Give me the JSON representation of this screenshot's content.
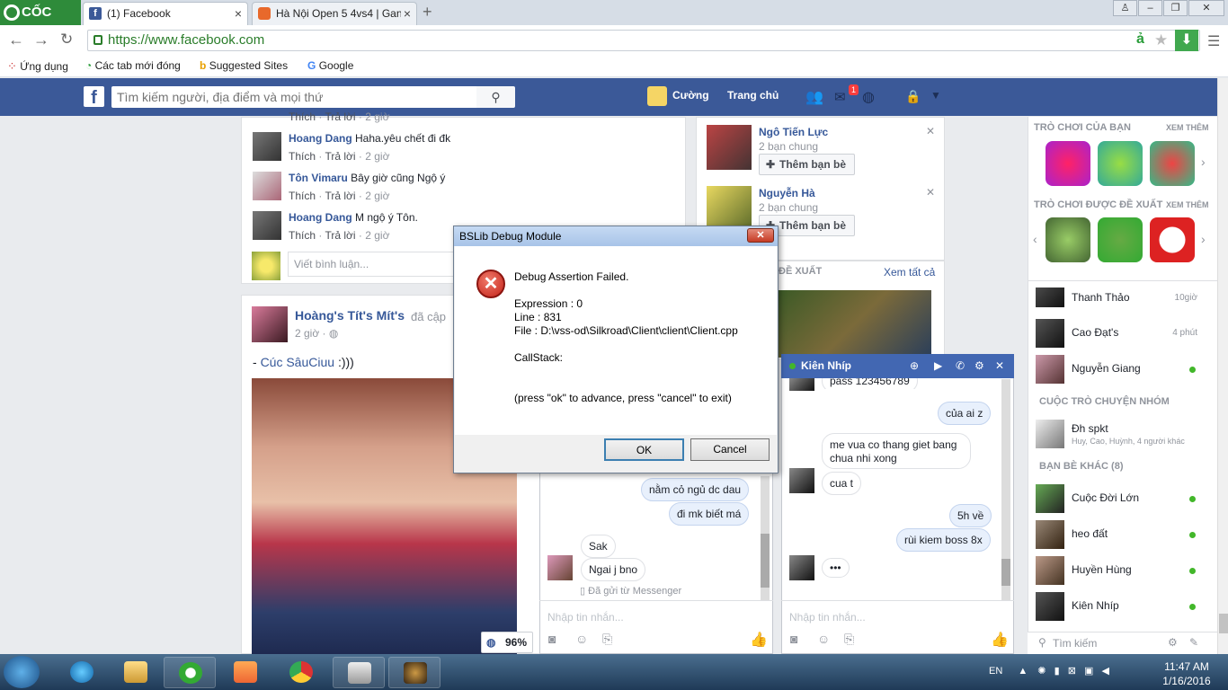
{
  "browser": {
    "logo": "CỐC CỐC",
    "tabs": [
      {
        "title": "(1) Facebook",
        "active": true
      },
      {
        "title": "Hà Nội Open 5 4vs4 | Gan",
        "active": false
      }
    ],
    "url": "https://www.facebook.com",
    "address_glyph": "ả",
    "bookmarks": [
      "Ứng dụng",
      "Các tab mới đóng",
      "Suggested Sites",
      "Google"
    ]
  },
  "fb_header": {
    "search_placeholder": "Tìm kiếm người, địa điểm và mọi thứ",
    "user": "Cường",
    "home": "Trang chủ",
    "message_badge": "1"
  },
  "feed": {
    "comments": [
      {
        "name": "Hoang Dang",
        "text": "Haha.yêu chết đi đk",
        "meta_like": "Thích",
        "meta_reply": "Trả lời",
        "meta_time": "2 giờ"
      },
      {
        "name": "Tôn Vimaru",
        "text": "Bây giờ cũng Ngộ ý",
        "meta_like": "Thích",
        "meta_reply": "Trả lời",
        "meta_time": "2 giờ"
      },
      {
        "name": "Hoang Dang",
        "text": "M ngộ ý Tôn.",
        "meta_like": "Thích",
        "meta_reply": "Trả lời",
        "meta_time": "2 giờ"
      }
    ],
    "partial_meta": {
      "like": "Thích",
      "reply": "Trả lời",
      "time": "2 giờ"
    },
    "comment_placeholder": "Viết bình luận...",
    "post": {
      "author": "Hoàng's Tít's Mít's",
      "action": "đã cập",
      "time": "2 giờ",
      "text_prefix": "- ",
      "text_link": "Cúc SâuCiuu",
      "text_suffix": " :)))",
      "zoom": "96%"
    }
  },
  "suggestions": {
    "people": [
      {
        "name": "Ngô Tiến Lực",
        "mutual": "2 bạn chung",
        "button": "Thêm bạn bè"
      },
      {
        "name": "Nguyễn Hà",
        "mutual": "2 bạn chung",
        "button": "Thêm bạn bè"
      }
    ],
    "section2_label": "ĐỀ XUẤT",
    "see_all": "Xem tất cả"
  },
  "sidebar": {
    "your_games": "TRÒ CHƠI CỦA BẠN",
    "suggested_games": "TRÒ CHƠI ĐƯỢC ĐỀ XUẤT",
    "see_more": "XEM THÊM",
    "contacts": [
      {
        "name": "Thanh Thảo",
        "status": "10giờ",
        "online": false
      },
      {
        "name": "Cao Đạt's",
        "status": "4 phút",
        "online": false
      },
      {
        "name": "Nguyễn Giang",
        "status": "",
        "online": true
      }
    ],
    "group_header": "CUỘC TRÒ CHUYỆN NHÓM",
    "group": {
      "name": "Đh spkt",
      "members": "Huy, Cao, Huỳnh, 4 người khác"
    },
    "other_header": "BẠN BÈ KHÁC (8)",
    "others": [
      {
        "name": "Cuộc Đời Lớn",
        "online": true
      },
      {
        "name": "heo đất",
        "online": true
      },
      {
        "name": "Huyền Hùng",
        "online": true
      },
      {
        "name": "Kiên Nhíp",
        "online": true
      }
    ],
    "search": "Tìm kiếm"
  },
  "chat1": {
    "messages_out": [
      "nằm cỏ ngủ dc dau",
      "đi mk biết má"
    ],
    "messages_in": [
      "Sak",
      "Ngai j bno"
    ],
    "sent_from": "Đã gửi từ Messenger",
    "placeholder": "Nhập tin nhắn..."
  },
  "chat2": {
    "title": "Kiên Nhíp",
    "messages": [
      {
        "dir": "in",
        "text": "pass 123456789"
      },
      {
        "dir": "out",
        "text": "của ai z"
      },
      {
        "dir": "in",
        "text": "me vua co thang giet bang"
      },
      {
        "dir": "in",
        "text": "chua nhi xong"
      },
      {
        "dir": "in",
        "text": "cua t"
      },
      {
        "dir": "out",
        "text": "5h về"
      },
      {
        "dir": "out",
        "text": "rùi kiem boss 8x"
      },
      {
        "dir": "in",
        "text": "•••"
      }
    ],
    "placeholder": "Nhập tin nhắn..."
  },
  "dialog": {
    "title": "BSLib Debug Module",
    "headline": "Debug Assertion Failed.",
    "expression": "Expression : 0",
    "line": "Line : 831",
    "file": "File : D:\\vss-od\\Silkroad\\Client\\client\\Client.cpp",
    "callstack": "CallStack:",
    "hint": "(press \"ok\" to advance, press \"cancel\" to exit)",
    "ok": "OK",
    "cancel": "Cancel"
  },
  "taskbar": {
    "lang": "EN",
    "time": "11:47 AM",
    "date": "1/16/2016"
  },
  "colors": {
    "fb_blue": "#3b5998",
    "chat_head": "#4267b2",
    "online": "#42b72a"
  }
}
